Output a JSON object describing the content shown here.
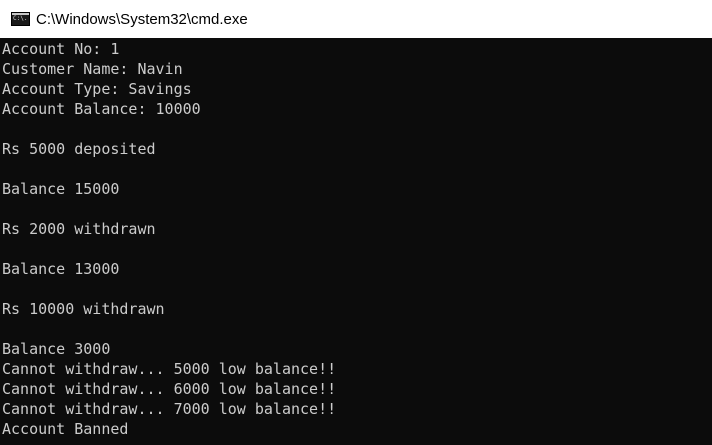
{
  "window": {
    "title": "C:\\Windows\\System32\\cmd.exe",
    "icon": "cmd-console-icon",
    "icon_text": "C:\\."
  },
  "console": {
    "lines": [
      "Account No: 1",
      "Customer Name: Navin",
      "Account Type: Savings",
      "Account Balance: 10000",
      "",
      "Rs 5000 deposited",
      "",
      "Balance 15000",
      "",
      "Rs 2000 withdrawn",
      "",
      "Balance 13000",
      "",
      "Rs 10000 withdrawn",
      "",
      "Balance 3000",
      "Cannot withdraw... 5000 low balance!!",
      "Cannot withdraw... 6000 low balance!!",
      "Cannot withdraw... 7000 low balance!!",
      "Account Banned"
    ]
  },
  "colors": {
    "console_bg": "#0c0c0c",
    "console_fg": "#cccccc",
    "titlebar_bg": "#ffffff"
  }
}
